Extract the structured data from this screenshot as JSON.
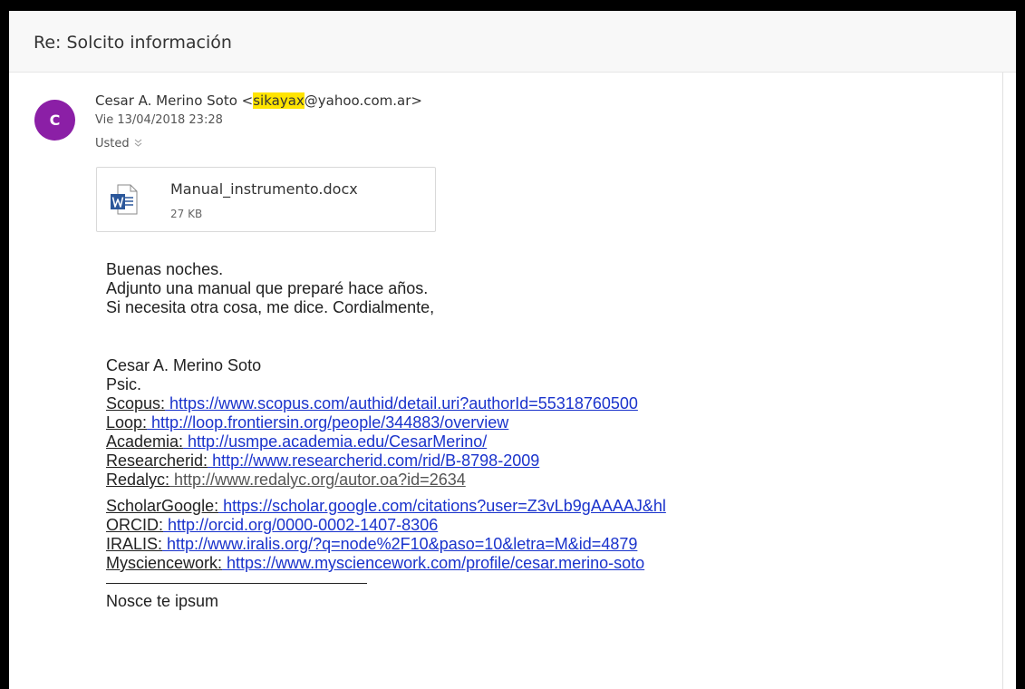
{
  "subject": "Re: Solcito información",
  "sender": {
    "avatar_initial": "C",
    "avatar_color": "#8b1fa6",
    "name_prefix": "Cesar A. Merino Soto <",
    "email_highlight": "sikayax",
    "email_suffix": "@yahoo.com.ar>",
    "highlight_color": "#ffe400"
  },
  "date": "Vie 13/04/2018 23:28",
  "to_label": "Usted",
  "attachment": {
    "icon": "word-doc-icon",
    "name": "Manual_instrumento.docx",
    "size": "27 KB"
  },
  "body_lines": {
    "greeting": "Buenas noches.",
    "line2": "Adjunto una manual que preparé hace años.",
    "line3": "Si necesita otra cosa, me dice. Cordialmente,"
  },
  "signature": {
    "name": "Cesar A. Merino Soto",
    "title": "Psic.",
    "links": [
      {
        "label": "Scopus:",
        "url": " https://www.scopus.com/authid/detail.uri?authorId=55318760500"
      },
      {
        "label": "Loop:",
        "url": " http://loop.frontiersin.org/people/344883/overview"
      },
      {
        "label": "Academia:",
        "url": " http://usmpe.academia.edu/CesarMerino/"
      },
      {
        "label": "Researcherid:",
        "url": " http://www.researcherid.com/rid/B-8798-2009"
      },
      {
        "label": "Redalyc:",
        "url": " http://www.redalyc.org/autor.oa?id=2634"
      },
      {
        "label": "ScholarGoogle:",
        "url": " https://scholar.google.com/citations?user=Z3vLb9gAAAAJ&hl"
      },
      {
        "label": "ORCID:",
        "url": " http://orcid.org/0000-0002-1407-8306"
      },
      {
        "label": "IRALIS:",
        "url": " http://www.iralis.org/?q=node%2F10&paso=10&letra=M&id=4879"
      },
      {
        "label": "Mysciencework:",
        "url": " https://www.mysciencework.com/profile/cesar.merino-soto"
      }
    ],
    "motto": "Nosce te ipsum"
  },
  "colors": {
    "link": "#1a33cc",
    "link_grey": "#555555"
  }
}
